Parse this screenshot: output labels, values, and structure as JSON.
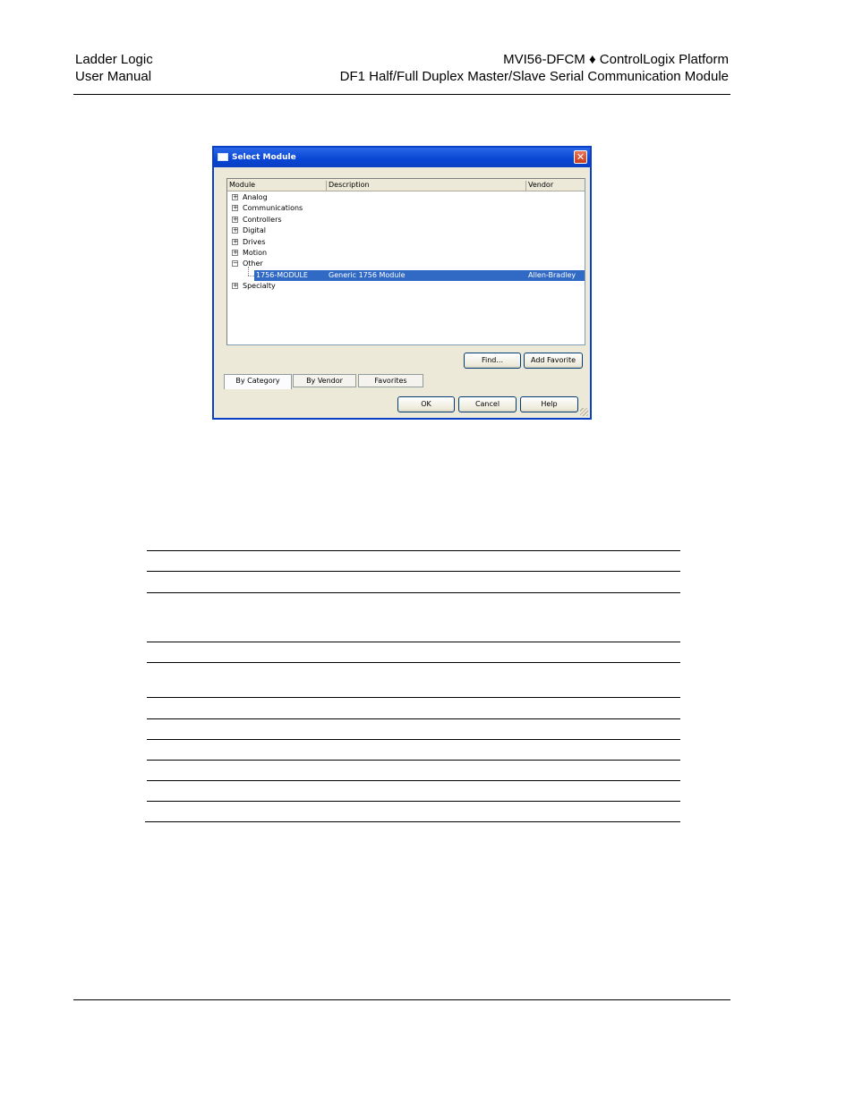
{
  "header": {
    "left_line1": "Ladder Logic",
    "left_line2": "User Manual",
    "right_line1": "MVI56-DFCM ♦ ControlLogix Platform",
    "right_line2": "DF1 Half/Full Duplex Master/Slave Serial Communication Module"
  },
  "dialog": {
    "title": "Select Module",
    "columns": [
      "Module",
      "Description",
      "Vendor"
    ],
    "tree": [
      {
        "label": "Analog",
        "expander": "+"
      },
      {
        "label": "Communications",
        "expander": "+"
      },
      {
        "label": "Controllers",
        "expander": "+"
      },
      {
        "label": "Digital",
        "expander": "+"
      },
      {
        "label": "Drives",
        "expander": "+"
      },
      {
        "label": "Motion",
        "expander": "+"
      },
      {
        "label": "Other",
        "expander": "−"
      },
      {
        "label": "Specialty",
        "expander": "+"
      }
    ],
    "selected_row": {
      "module": "1756-MODULE",
      "description": "Generic 1756 Module",
      "vendor": "Allen-Bradley"
    },
    "find_button": "Find...",
    "add_favorite_button": "Add Favorite",
    "tabs": [
      "By Category",
      "By Vendor",
      "Favorites"
    ],
    "ok_button": "OK",
    "cancel_button": "Cancel",
    "help_button": "Help"
  }
}
